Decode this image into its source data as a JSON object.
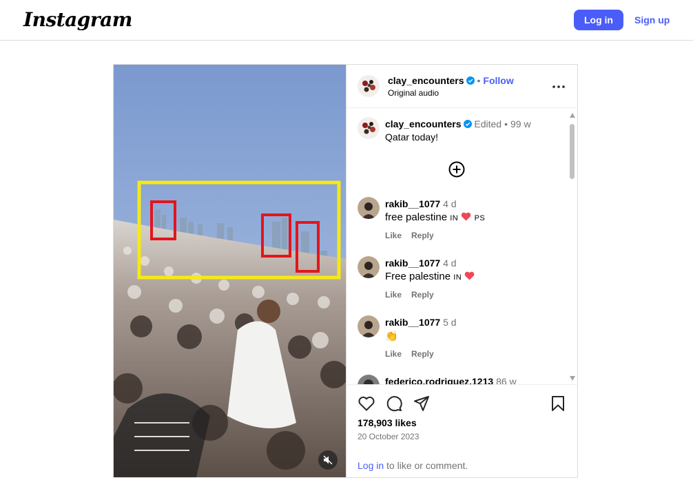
{
  "brand": {
    "logo_text": "Instagram"
  },
  "topbar": {
    "login_label": "Log in",
    "signup_label": "Sign up"
  },
  "colors": {
    "accent": "#4a5df9",
    "verified": "#0095f6",
    "heart": "#ed4956",
    "annotation_yellow": "#f5ea14",
    "annotation_red": "#e3151b"
  },
  "post": {
    "author": "clay_encounters",
    "follow_label": "Follow",
    "audio_label": "Original audio",
    "caption": {
      "author": "clay_encounters",
      "edited_label": "Edited",
      "age": "99 w",
      "text": "Qatar today!"
    },
    "comments": [
      {
        "author": "rakib__1077",
        "age": "4 d",
        "text": "free palestine",
        "flag_text": "IN",
        "trail_text": "PS",
        "has_heart": true,
        "like_label": "Like",
        "reply_label": "Reply"
      },
      {
        "author": "rakib__1077",
        "age": "4 d",
        "text": "Free palestine",
        "flag_text": "IN",
        "trail_text": "",
        "has_heart": true,
        "like_label": "Like",
        "reply_label": "Reply"
      },
      {
        "author": "rakib__1077",
        "age": "5 d",
        "text": "👏",
        "flag_text": "",
        "trail_text": "",
        "has_heart": false,
        "like_label": "Like",
        "reply_label": "Reply"
      },
      {
        "author": "federico.rodriguez.1213",
        "age": "86 w"
      }
    ],
    "likes_text": "178,903 likes",
    "date_text": "20 October 2023",
    "login_link": "Log in",
    "login_suffix": " to like or comment."
  },
  "icons": {
    "verified": "verified-badge-icon",
    "more": "more-options-icon",
    "load_more": "plus-circle-icon",
    "like": "heart-icon",
    "comment": "comment-icon",
    "share": "share-icon",
    "save": "bookmark-icon",
    "mute": "muted-speaker-icon"
  }
}
